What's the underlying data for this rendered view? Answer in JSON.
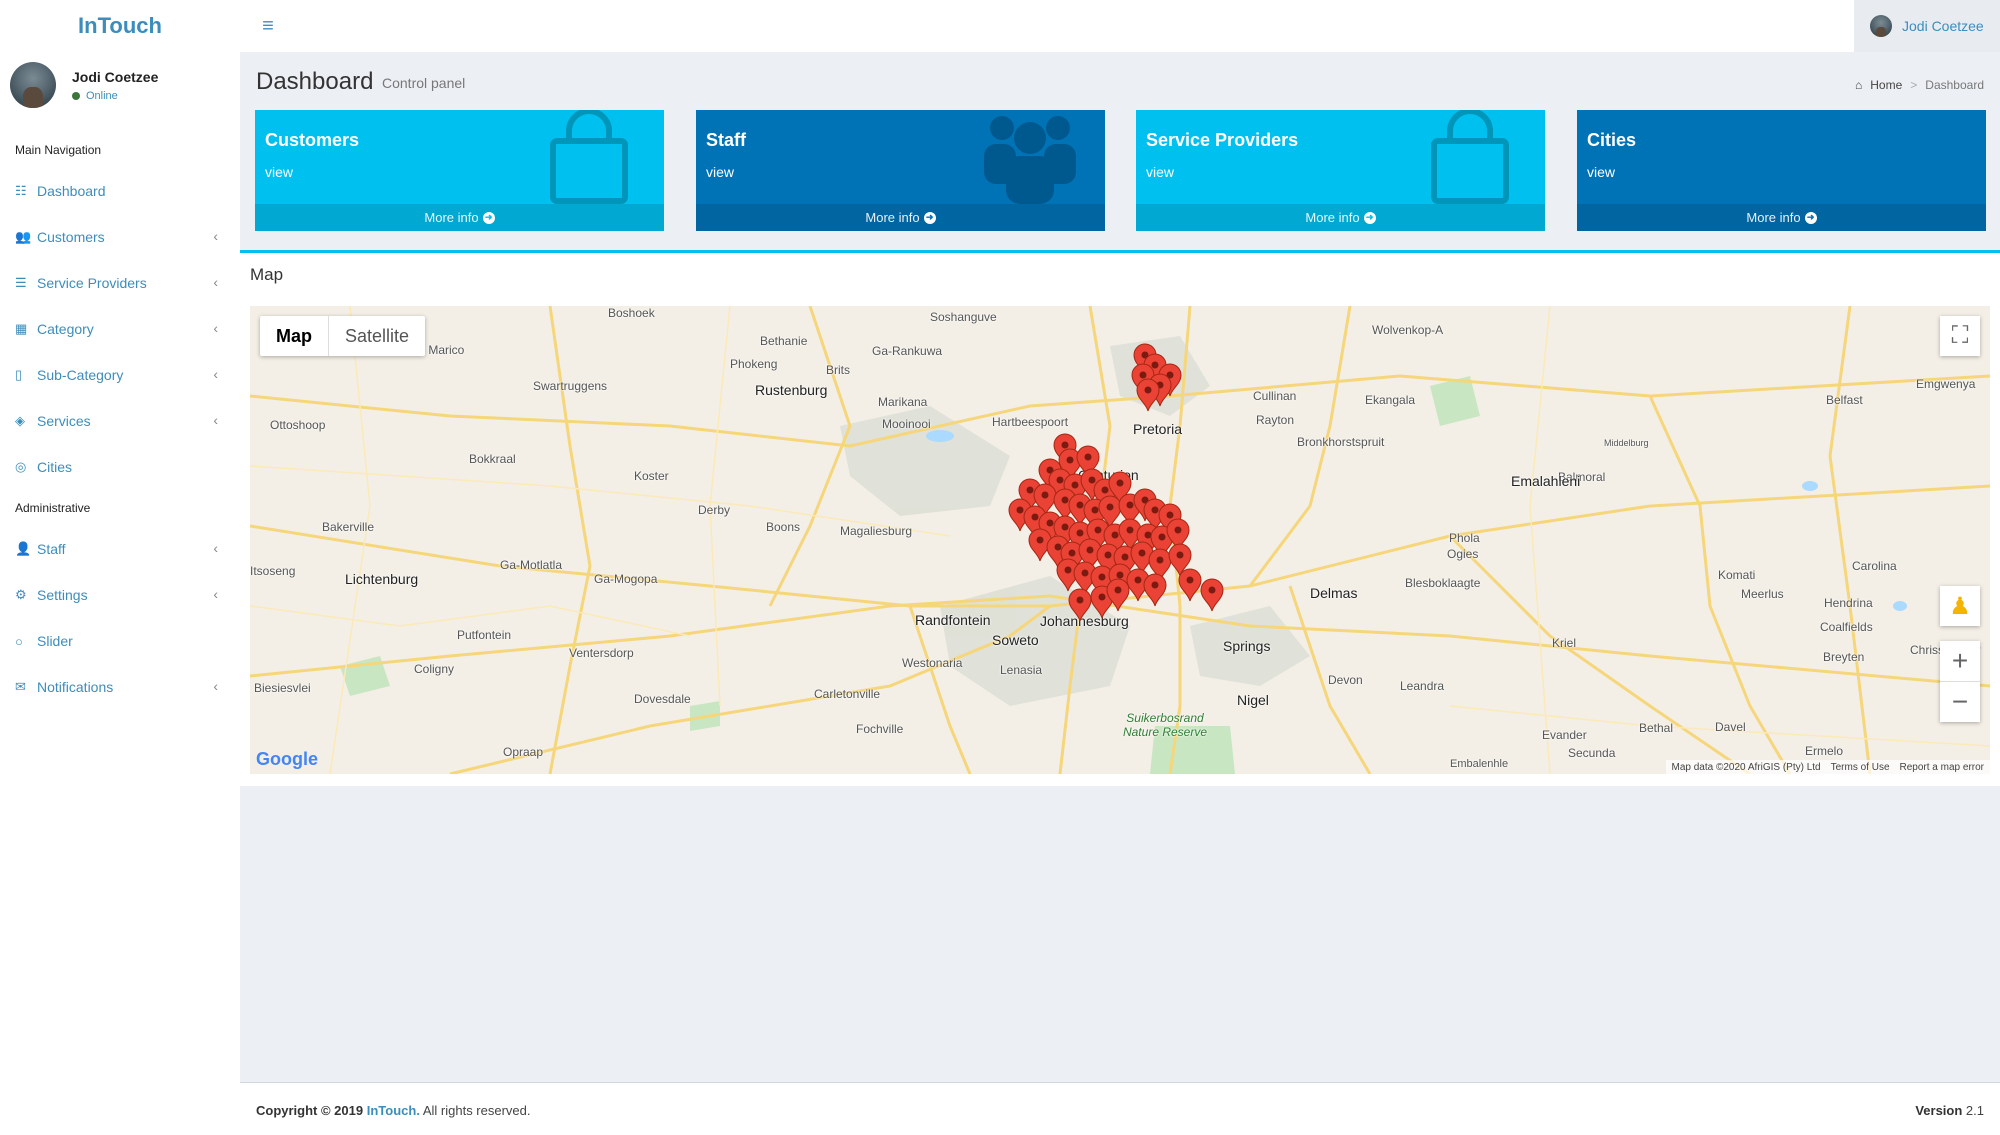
{
  "app": {
    "brand": "InTouch"
  },
  "topbar": {
    "user_name": "Jodi Coetzee"
  },
  "sidebar": {
    "user_name": "Jodi Coetzee",
    "user_status": "Online",
    "section_main": "Main Navigation",
    "section_admin": "Administrative",
    "items": [
      {
        "label": "Dashboard",
        "icon": "sliders-icon"
      },
      {
        "label": "Customers",
        "icon": "users-icon"
      },
      {
        "label": "Service Providers",
        "icon": "list-icon"
      },
      {
        "label": "Category",
        "icon": "grid-icon"
      },
      {
        "label": "Sub-Category",
        "icon": "file-icon"
      },
      {
        "label": "Services",
        "icon": "tags-icon"
      },
      {
        "label": "Cities",
        "icon": "compass-icon"
      }
    ],
    "admin_items": [
      {
        "label": "Staff",
        "icon": "user-icon"
      },
      {
        "label": "Settings",
        "icon": "gear-icon"
      },
      {
        "label": "Slider",
        "icon": "circle-icon"
      },
      {
        "label": "Notifications",
        "icon": "envelope-icon"
      }
    ]
  },
  "header": {
    "title": "Dashboard",
    "subtitle": "Control panel",
    "breadcrumb": [
      "Home",
      "Dashboard"
    ]
  },
  "boxes": [
    {
      "title": "Customers",
      "value": "view",
      "link": "More info",
      "color": "#00c0ef",
      "icon": "bag-icon"
    },
    {
      "title": "Staff",
      "value": "view",
      "link": "More info",
      "color": "#0073b7",
      "icon": "users-icon"
    },
    {
      "title": "Service Providers",
      "value": "view",
      "link": "More info",
      "color": "#00c0ef",
      "icon": "bag-icon"
    },
    {
      "title": "Cities",
      "value": "view",
      "link": "More info",
      "color": "#0073b7",
      "icon": ""
    }
  ],
  "map": {
    "title": "Map",
    "type_options": [
      "Map",
      "Satellite"
    ],
    "selected_type": "Map",
    "places": [
      "Boshoek",
      "Soshanguve",
      "Wolvenkop-A",
      "Bethanie",
      "Ga-Rankuwa",
      "Groot Marico",
      "Phokeng",
      "Brits",
      "Cullinan",
      "Ekangala",
      "Emgwenya",
      "Swartruggens",
      "Rustenburg",
      "Marikana",
      "Belfast",
      "Mooinooi",
      "Hartbeespoort",
      "Rayton",
      "Ottoshoop",
      "Pretoria",
      "Bronkhorstspruit",
      "Middelburg",
      "Bokkraal",
      "Centurion",
      "Balmoral",
      "Emalahleni",
      "Koster",
      "Derby",
      "Bakerville",
      "Boons",
      "Magaliesburg",
      "Phola",
      "Ogies",
      "Carolina",
      "Ga-Motlatla",
      "Ga-Mogopa",
      "Komati",
      "Blesboklaagte",
      "Meerlus",
      "Hendrina",
      "Itsoseng",
      "Lichtenburg",
      "Delmas",
      "Randfontein",
      "Johannesburg",
      "Soweto",
      "Springs",
      "Coalfields",
      "Putfontein",
      "Ventersdorp",
      "Kriel",
      "Chrissiemeer",
      "Westonaria",
      "Breyten",
      "Coligny",
      "Lenasia",
      "Biesiesvlei",
      "Devon",
      "Leandra",
      "Carletonville",
      "Dovesdale",
      "Nigel",
      "Fochville",
      "Suikerbosrand Nature Reserve",
      "Bethal",
      "Davel",
      "Evander",
      "Opraap",
      "Secunda",
      "Ermelo",
      "Embalenhle"
    ],
    "attribution": [
      "Map data ©2020 AfriGIS (Pty) Ltd",
      "Terms of Use",
      "Report a map error"
    ],
    "logo": "Google"
  },
  "footer": {
    "copyright_prefix": "Copyright © 2019",
    "brand": "InTouch.",
    "suffix": "All rights reserved.",
    "version_label": "Version",
    "version": "2.1"
  }
}
